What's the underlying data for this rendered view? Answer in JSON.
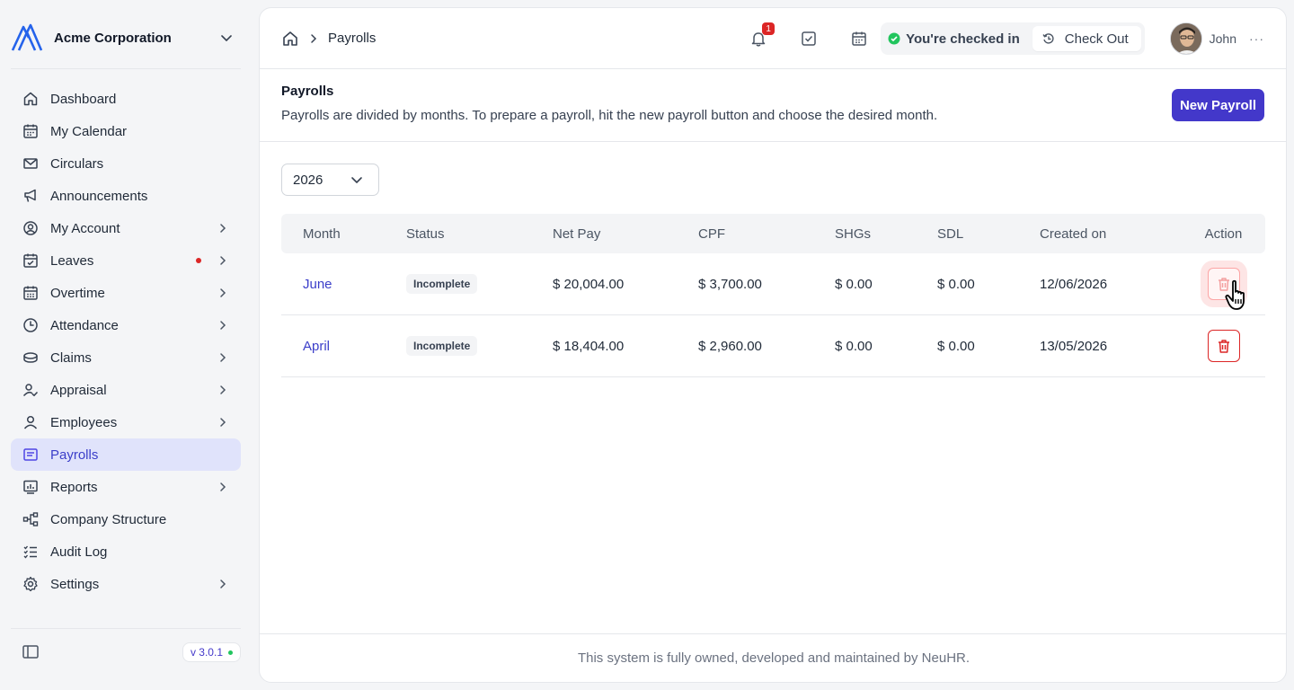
{
  "sidebar": {
    "brand": "Acme Corporation",
    "items": [
      {
        "label": "Dashboard"
      },
      {
        "label": "My Calendar"
      },
      {
        "label": "Circulars"
      },
      {
        "label": "Announcements"
      },
      {
        "label": "My Account"
      },
      {
        "label": "Leaves"
      },
      {
        "label": "Overtime"
      },
      {
        "label": "Attendance"
      },
      {
        "label": "Claims"
      },
      {
        "label": "Appraisal"
      },
      {
        "label": "Employees"
      },
      {
        "label": "Payrolls"
      },
      {
        "label": "Reports"
      },
      {
        "label": "Company Structure"
      },
      {
        "label": "Audit Log"
      },
      {
        "label": "Settings"
      }
    ],
    "version": "v 3.0.1"
  },
  "topbar": {
    "breadcrumb": "Payrolls",
    "notification_count": "1",
    "checkin_status": "You're checked in",
    "checkout_label": "Check Out",
    "user_name": "John",
    "more": "···"
  },
  "page": {
    "title": "Payrolls",
    "description": "Payrolls are divided by months. To prepare a payroll, hit the new payroll button and choose the desired month.",
    "new_button": "New Payroll",
    "year": "2026"
  },
  "table": {
    "headers": [
      "Month",
      "Status",
      "Net Pay",
      "CPF",
      "SHGs",
      "SDL",
      "Created on",
      "Action"
    ],
    "rows": [
      {
        "month": "June",
        "status": "Incomplete",
        "net_pay": "$ 20,004.00",
        "cpf": "$ 3,700.00",
        "shgs": "$ 0.00",
        "sdl": "$ 0.00",
        "created_on": "12/06/2026"
      },
      {
        "month": "April",
        "status": "Incomplete",
        "net_pay": "$ 18,404.00",
        "cpf": "$ 2,960.00",
        "shgs": "$ 0.00",
        "sdl": "$ 0.00",
        "created_on": "13/05/2026"
      }
    ]
  },
  "footer": "This system is fully owned, developed and maintained by NeuHR.",
  "colors": {
    "accent": "#4338ca",
    "active_bg": "#e0e3fb",
    "danger": "#dc2626",
    "success": "#22c55e"
  }
}
